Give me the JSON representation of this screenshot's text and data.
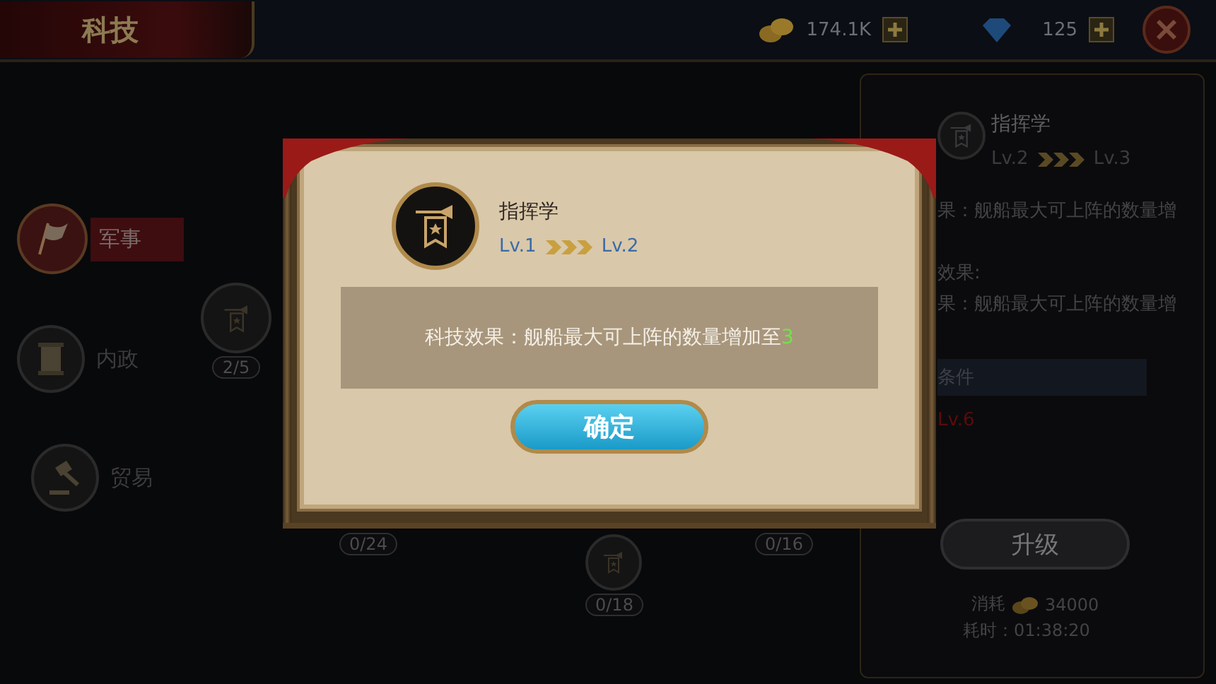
{
  "top_bar": {
    "title": "科技",
    "resources": [
      {
        "kind": "gold",
        "amount": "174.1K"
      },
      {
        "kind": "gem",
        "amount": "125"
      }
    ]
  },
  "sidebar": {
    "items": [
      {
        "label": "军事",
        "selected": true
      },
      {
        "label": "内政",
        "selected": false
      },
      {
        "label": "贸易",
        "selected": false
      }
    ]
  },
  "tree": {
    "nodes": [
      {
        "progress": "2/5"
      },
      {
        "progress": "0/24"
      },
      {
        "progress": "0/18"
      },
      {
        "progress": "0/16"
      }
    ]
  },
  "detail_panel": {
    "name": "指挥学",
    "level_from": "Lv.2",
    "level_to": "Lv.3",
    "current_effect": "果：舰船最大可上阵的数量增",
    "next_effect_label": "效果:",
    "next_effect": "果：舰船最大可上阵的数量增",
    "requirements_heading": "条件",
    "requirement": "Lv.6",
    "requirement_met": false,
    "upgrade_button": "升级",
    "cost_label": "消耗",
    "cost": "34000",
    "time": "耗时：01:38:20"
  },
  "dialog": {
    "name": "指挥学",
    "level_from": "Lv.1",
    "level_to": "Lv.2",
    "effect": "科技效果：舰船最大可上阵的数量增加至",
    "effect_value": "3",
    "confirm_button": "确定"
  }
}
